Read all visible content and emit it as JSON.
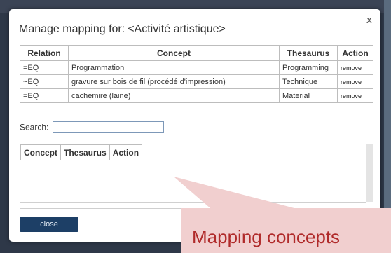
{
  "dialog": {
    "title_prefix": "Manage mapping for:",
    "concept_name": "<Activité artistique>",
    "close_glyph": "x"
  },
  "mapping_table": {
    "headers": [
      "Relation",
      "Concept",
      "Thesaurus",
      "Action"
    ],
    "rows": [
      {
        "relation": "=EQ",
        "concept": "Programmation",
        "thesaurus": "Programming",
        "action": "remove"
      },
      {
        "relation": "~EQ",
        "concept": "gravure sur bois de fil (procédé d'impression)",
        "thesaurus": "Technique",
        "action": "remove"
      },
      {
        "relation": "=EQ",
        "concept": "cachemire (laine)",
        "thesaurus": "Material",
        "action": "remove"
      }
    ]
  },
  "search": {
    "label": "Search:",
    "value": ""
  },
  "results_table": {
    "headers": [
      "Concept",
      "Thesaurus",
      "Action"
    ]
  },
  "buttons": {
    "close_label": "close"
  },
  "callout": {
    "text": "Mapping concepts"
  },
  "colors": {
    "close_button": "#1d3f66",
    "callout_bg": "#f1cfcf",
    "callout_text": "#b02a2a"
  }
}
